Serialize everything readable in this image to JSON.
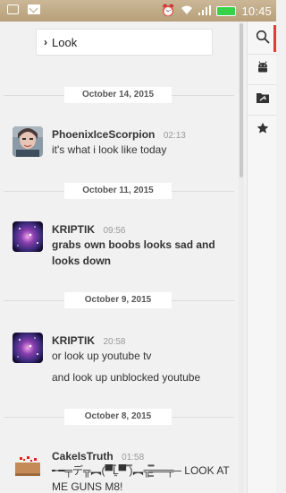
{
  "status_bar": {
    "time": "10:45"
  },
  "search": {
    "value": "Look"
  },
  "feed": [
    {
      "date": "October 14, 2015",
      "messages": [
        {
          "author": "PhoenixIceScorpion",
          "time": "02:13",
          "lines": [
            "it's what i look like today"
          ],
          "bold": false,
          "avatar": "photo"
        }
      ]
    },
    {
      "date": "October 11, 2015",
      "messages": [
        {
          "author": "KRIPTIK",
          "time": "09:56",
          "lines": [
            "grabs own boobs looks sad and looks down"
          ],
          "bold": true,
          "avatar": "galaxy"
        }
      ]
    },
    {
      "date": "October 9, 2015",
      "messages": [
        {
          "author": "KRIPTIK",
          "time": "20:58",
          "lines": [
            "or look up youtube tv",
            "and look up unblocked youtube"
          ],
          "bold": false,
          "avatar": "galaxy"
        }
      ]
    },
    {
      "date": "October 8, 2015",
      "messages": [
        {
          "author": "CakeIsTruth",
          "time": "01:58",
          "lines": [
            "╾━╤デ╦︻(▀̿Ĺ̯▀̿ ̿)︻╦̵̵͇̿̿̿̿══╤─ LOOK AT ME GUNS M8!"
          ],
          "bold": false,
          "avatar": "cake"
        }
      ]
    }
  ],
  "rail": {
    "items": [
      {
        "icon": "search-icon",
        "active": true
      },
      {
        "icon": "android-icon",
        "active": false
      },
      {
        "icon": "folder-share-icon",
        "active": false
      },
      {
        "icon": "star-icon",
        "active": false
      }
    ]
  }
}
